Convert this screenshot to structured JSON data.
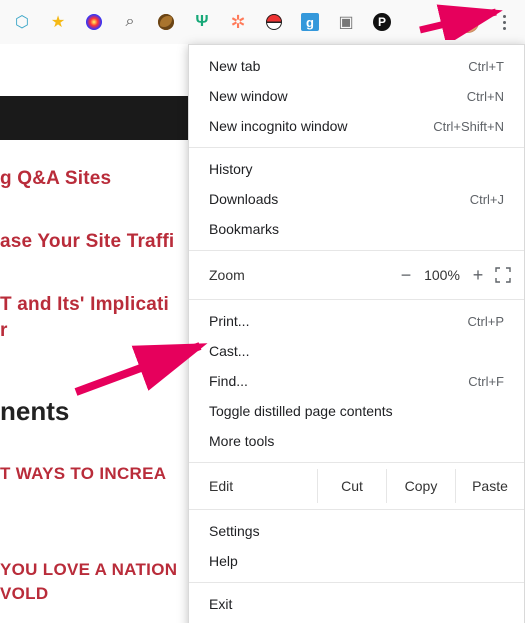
{
  "toolbar": {
    "icons": [
      "hex-icon",
      "star-icon",
      "circle-icon",
      "magnify-icon",
      "cookie-icon",
      "antler-icon",
      "hubspot-icon",
      "pokeball-icon",
      "g-square-icon",
      "camera-icon",
      "p-bubble-icon"
    ]
  },
  "page": {
    "blackbar": "",
    "link1": "g Q&A Sites",
    "link2": "ase Your Site Traffi",
    "link3a": "T and Its' Implicati",
    "link3b": "r",
    "heading": "nents",
    "caps1": "T WAYS TO INCREA",
    "caps2a": "YOU LOVE A NATION",
    "caps2b": "VOLD"
  },
  "menu": {
    "newtab": {
      "label": "New tab",
      "shortcut": "Ctrl+T"
    },
    "newwin": {
      "label": "New window",
      "shortcut": "Ctrl+N"
    },
    "incog": {
      "label": "New incognito window",
      "shortcut": "Ctrl+Shift+N"
    },
    "history": {
      "label": "History"
    },
    "downloads": {
      "label": "Downloads",
      "shortcut": "Ctrl+J"
    },
    "bookmarks": {
      "label": "Bookmarks"
    },
    "zoom": {
      "label": "Zoom",
      "minus": "−",
      "pct": "100%",
      "plus": "+"
    },
    "print": {
      "label": "Print...",
      "shortcut": "Ctrl+P"
    },
    "cast": {
      "label": "Cast..."
    },
    "find": {
      "label": "Find...",
      "shortcut": "Ctrl+F"
    },
    "distill": {
      "label": "Toggle distilled page contents"
    },
    "moretools": {
      "label": "More tools"
    },
    "edit": {
      "label": "Edit",
      "cut": "Cut",
      "copy": "Copy",
      "paste": "Paste"
    },
    "settings": {
      "label": "Settings"
    },
    "help": {
      "label": "Help"
    },
    "exit": {
      "label": "Exit"
    }
  }
}
